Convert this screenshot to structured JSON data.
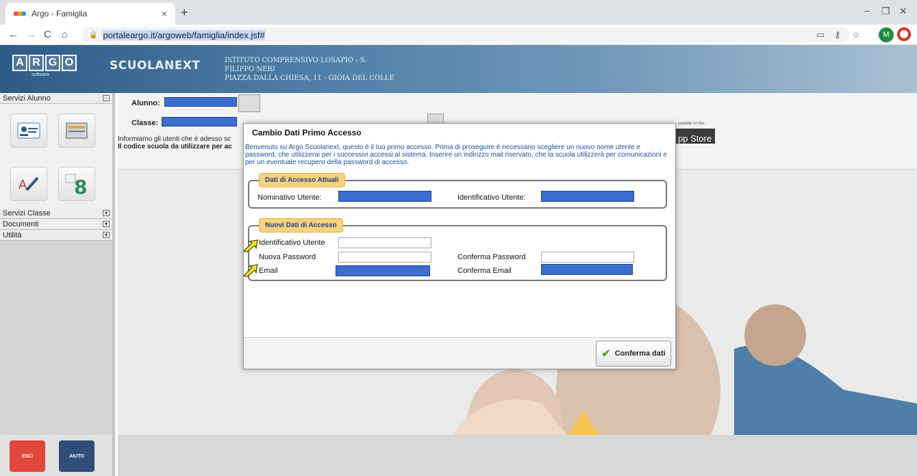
{
  "browser": {
    "tab_title": "Argo - Famiglia",
    "tab_close": "×",
    "new_tab": "+",
    "url_prefix": "portaleargo.it/argoweb/famiglia/index.jsf#",
    "avatar_letter": "M",
    "window_controls": [
      "−",
      "❐",
      "✕"
    ],
    "nav": [
      "←",
      "→",
      "C",
      "⌂"
    ]
  },
  "header": {
    "logo_letters": [
      "A",
      "R",
      "G",
      "O"
    ],
    "logo_sub": "software",
    "product": "SCUOLANEXT",
    "school_line1": "ISTITUTO COMPRENSIVO LOSAPIO - S.",
    "school_line2": "FILIPPO NERI",
    "school_line3": "PIAZZA DALLA CHIESA, 11 - GIOIA DEL COLLE"
  },
  "sidebar": {
    "sections": [
      {
        "label": "Servizi Alunno",
        "toggle": "−"
      },
      {
        "label": "Servizi Classe",
        "toggle": "▾"
      },
      {
        "label": "Documenti",
        "toggle": "▾"
      },
      {
        "label": "Utilità",
        "toggle": "▾"
      }
    ],
    "exit_label": "ESCI",
    "help_label": "AIUTO",
    "exit_color": "#e2463c",
    "help_color": "#2f4f7a"
  },
  "main": {
    "alunno_label": "Alunno:",
    "classe_label": "Classe:",
    "info_line1": "Informiamo gli utenti che è adesso sc",
    "info_line2": "Il codice scuola da utilizzare per ac",
    "appstore_text": "pp Store",
    "appstore_small": "vailable on the"
  },
  "modal": {
    "title": "Cambio Dati Primo Accesso",
    "intro": "Benvenuto su Argo Scuolanext, questo è il tuo primo accesso. Prima di proseguire è necessario scegliere un nuovo nome utente e password, che utilizzerai per i successivi accessi al sistema. Inserire un indirizzo mail riservato, che la scuola utilizzerà per comunicazioni e per un eventuale recupero della password di accesso.",
    "current": {
      "legend": "Dati di Accesso Attuali",
      "name_label": "Nominativo Utente:",
      "id_label": "Identificativo Utente:"
    },
    "new": {
      "legend": "Nuovi Dati di Accesso",
      "id_label": "Identificativo Utente",
      "password_label": "Nuova Password",
      "confirm_password_label": "Conferma Password",
      "email_label": "Email",
      "confirm_email_label": "Conferma Email",
      "id_value": "",
      "password_value": "",
      "confirm_password_value": ""
    },
    "confirm_button": "Conferma dati",
    "check_glyph": "✔"
  },
  "colors": {
    "redaction": "#3a6fcf",
    "legend_bg": "#f9d27a",
    "intro_text": "#1b4fa0"
  }
}
